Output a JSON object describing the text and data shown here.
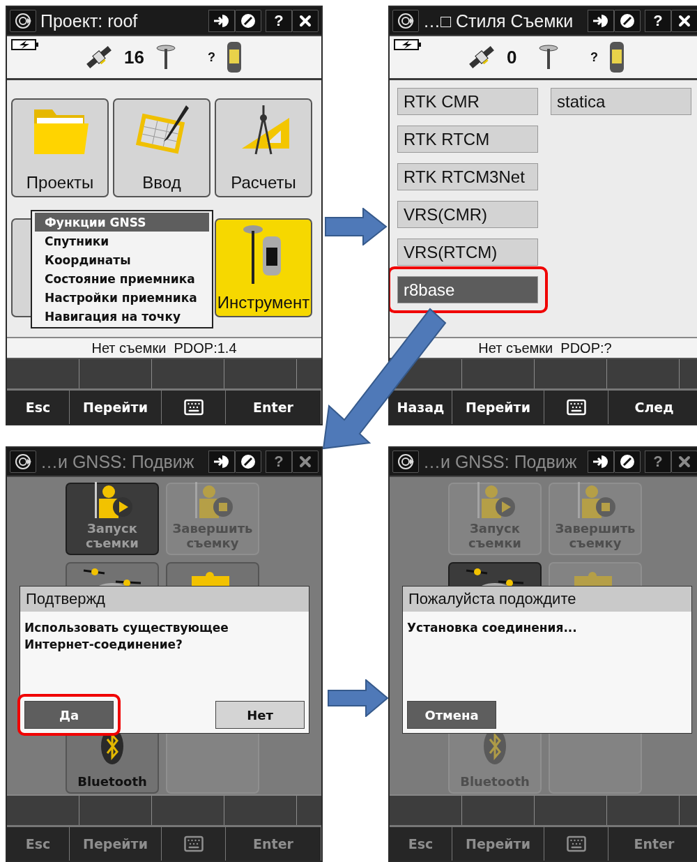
{
  "screens": [
    {
      "kind": "menu",
      "title": "Проект: roof",
      "help": "?",
      "satellites": "16",
      "receiver": "?",
      "tiles": [
        {
          "kind": "folder",
          "label": "Проекты",
          "selected": false
        },
        {
          "kind": "entry",
          "label": "Ввод",
          "selected": false
        },
        {
          "kind": "calc",
          "label": "Расчеты",
          "selected": false
        },
        {
          "kind": "blank",
          "selected": false
        },
        {
          "kind": "instrument",
          "label": "Инструмент",
          "selected": true
        }
      ],
      "popup_menu": [
        {
          "label": "Функции GNSS",
          "selected": true
        },
        {
          "label": "Спутники",
          "selected": false
        },
        {
          "label": "Координаты",
          "selected": false
        },
        {
          "label": "Состояние приемника",
          "selected": false
        },
        {
          "label": "Настройки приемника",
          "selected": false
        },
        {
          "label": "Навигация на точку",
          "selected": false
        }
      ],
      "status": "Нет съемки  PDOP:1.4",
      "softkeys": [
        {
          "kind": "text",
          "label": "Esc"
        },
        {
          "kind": "text",
          "label": "Перейти"
        },
        {
          "kind": "keyboard"
        },
        {
          "kind": "text",
          "label": "Enter"
        }
      ]
    },
    {
      "kind": "styles",
      "title": "…□ Стиля Съемки",
      "help": "?",
      "satellites": "0",
      "receiver": "?",
      "style_columns": [
        [
          {
            "label": "RTK CMR",
            "selected": false,
            "highlighted": false
          },
          {
            "label": "RTK RTCM",
            "selected": false,
            "highlighted": false
          },
          {
            "label": "RTK RTCM3Net",
            "selected": false,
            "highlighted": false
          },
          {
            "label": "VRS(CMR)",
            "selected": false,
            "highlighted": false
          },
          {
            "label": "VRS(RTCM)",
            "selected": false,
            "highlighted": false
          },
          {
            "label": "r8base",
            "selected": true,
            "highlighted": true
          }
        ],
        [
          {
            "label": "statica",
            "selected": false,
            "highlighted": false
          }
        ]
      ],
      "status": "Нет съемки  PDOP:?",
      "softkeys": [
        {
          "kind": "text",
          "label": "Назад"
        },
        {
          "kind": "text",
          "label": "Перейти"
        },
        {
          "kind": "keyboard"
        },
        {
          "kind": "text",
          "label": "След"
        }
      ]
    },
    {
      "kind": "dialog",
      "title": "…и GNSS: Подвиж",
      "help": "?",
      "tiles": [
        {
          "kind": "start",
          "label": "Запуск съемки",
          "selected": true,
          "disabled": false
        },
        {
          "kind": "stop",
          "label": "Завершить съемку",
          "selected": false,
          "disabled": true
        },
        {
          "kind": "rover",
          "selected": false,
          "disabled": false
        },
        {
          "kind": "puzzle",
          "selected": false,
          "disabled": false
        },
        {
          "kind": "bluetooth",
          "label": "Bluetooth",
          "selected": false,
          "disabled": false
        },
        {
          "kind": "blank",
          "selected": false,
          "disabled": true
        }
      ],
      "dialog": {
        "title": "Подтвержд",
        "message": "Использовать существующее Интернет-соединение?",
        "buttons": [
          {
            "label": "Да",
            "selected": true,
            "highlighted": true
          },
          {
            "label": "Нет",
            "selected": false,
            "highlighted": false
          }
        ]
      },
      "softkeys": [
        {
          "kind": "text",
          "label": "Esc"
        },
        {
          "kind": "text",
          "label": "Перейти"
        },
        {
          "kind": "keyboard"
        },
        {
          "kind": "text",
          "label": "Enter"
        }
      ]
    },
    {
      "kind": "dialog",
      "title": "…и GNSS: Подвиж",
      "help": "?",
      "tiles": [
        {
          "kind": "start",
          "label": "Запуск съемки",
          "selected": false,
          "disabled": true
        },
        {
          "kind": "stop",
          "label": "Завершить съемку",
          "selected": false,
          "disabled": true
        },
        {
          "kind": "rover",
          "selected": true,
          "disabled": false
        },
        {
          "kind": "puzzle",
          "selected": false,
          "disabled": true
        },
        {
          "kind": "bluetooth",
          "label": "Bluetooth",
          "selected": false,
          "disabled": true
        },
        {
          "kind": "blank",
          "selected": false,
          "disabled": true
        }
      ],
      "dialog": {
        "title": "Пожалуйста подождите",
        "message": "Установка соединения...",
        "buttons": [
          {
            "label": "Отмена",
            "selected": true,
            "highlighted": false
          }
        ]
      },
      "softkeys": [
        {
          "kind": "text",
          "label": "Esc"
        },
        {
          "kind": "text",
          "label": "Перейти"
        },
        {
          "kind": "keyboard"
        },
        {
          "kind": "text",
          "label": "Enter"
        }
      ]
    }
  ]
}
